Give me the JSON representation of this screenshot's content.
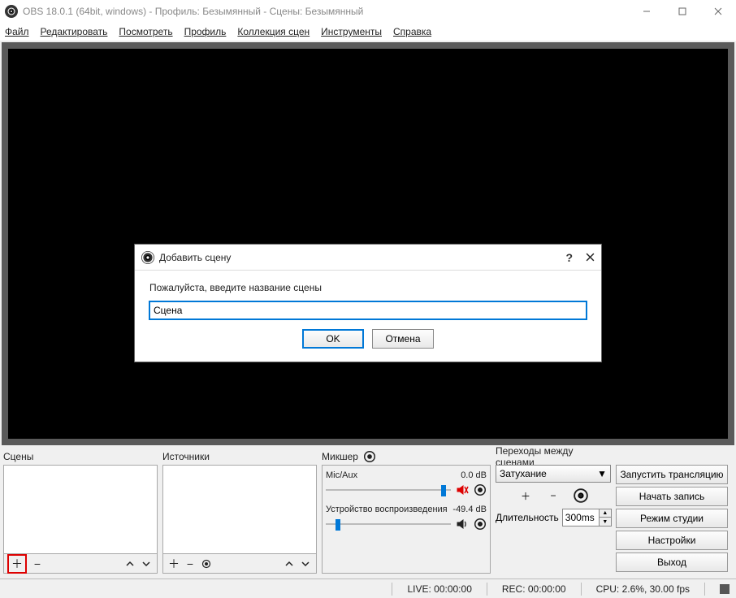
{
  "title": "OBS 18.0.1 (64bit, windows) - Профиль: Безымянный - Сцены: Безымянный",
  "menu": {
    "file": "Файл",
    "edit": "Редактировать",
    "view": "Посмотреть",
    "profile": "Профиль",
    "scene_collection": "Коллекция сцен",
    "tools": "Инструменты",
    "help": "Справка"
  },
  "panels": {
    "scenes": {
      "title": "Сцены"
    },
    "sources": {
      "title": "Источники"
    },
    "mixer": {
      "title": "Микшер",
      "tracks": [
        {
          "name": "Mic/Aux",
          "db": "0.0 dB",
          "slider_pos": 0.92,
          "muted": true
        },
        {
          "name": "Устройство воспроизведения",
          "db": "-49.4 dB",
          "slider_pos": 0.08,
          "muted": false
        }
      ]
    },
    "transitions": {
      "title": "Переходы между сценами",
      "selected": "Затухание",
      "duration_label": "Длительность",
      "duration_value": "300ms"
    }
  },
  "controls": {
    "start_stream": "Запустить трансляцию",
    "start_record": "Начать запись",
    "studio_mode": "Режим студии",
    "settings": "Настройки",
    "exit": "Выход"
  },
  "status": {
    "live": "LIVE: 00:00:00",
    "rec": "REC: 00:00:00",
    "cpu": "CPU: 2.6%, 30.00 fps"
  },
  "dialog": {
    "title": "Добавить сцену",
    "prompt": "Пожалуйста, введите название сцены",
    "value": "Сцена",
    "ok": "OK",
    "cancel": "Отмена"
  }
}
